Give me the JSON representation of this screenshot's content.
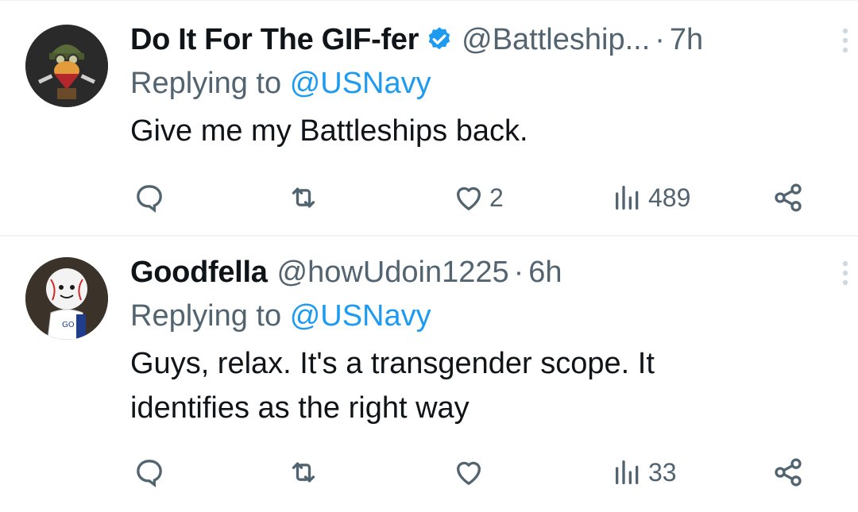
{
  "tweets": [
    {
      "author_name": "Do It For The GIF-fer",
      "verified": true,
      "handle": "@Battleship...",
      "separator": "·",
      "time": "7h",
      "replying_prefix": "Replying to",
      "replying_to": "@USNavy",
      "text": "Give me my Battleships back.",
      "replies": "",
      "retweets": "",
      "likes": "2",
      "views": "489"
    },
    {
      "author_name": "Goodfella",
      "verified": false,
      "handle": "@howUdoin1225",
      "separator": "·",
      "time": "6h",
      "replying_prefix": "Replying to",
      "replying_to": "@USNavy",
      "text_line1": "Guys, relax. It's a transgender scope. It",
      "text_line2": "identifies as the right way",
      "replies": "",
      "retweets": "",
      "likes": "",
      "views": "33"
    }
  ],
  "colors": {
    "text_primary": "#0f1419",
    "text_secondary": "#536471",
    "accent": "#1d9bf0",
    "divider": "#eff3f4"
  },
  "icons": [
    "verified-badge-icon",
    "more-options-icon",
    "reply-icon",
    "retweet-icon",
    "like-icon",
    "views-icon",
    "share-icon"
  ]
}
